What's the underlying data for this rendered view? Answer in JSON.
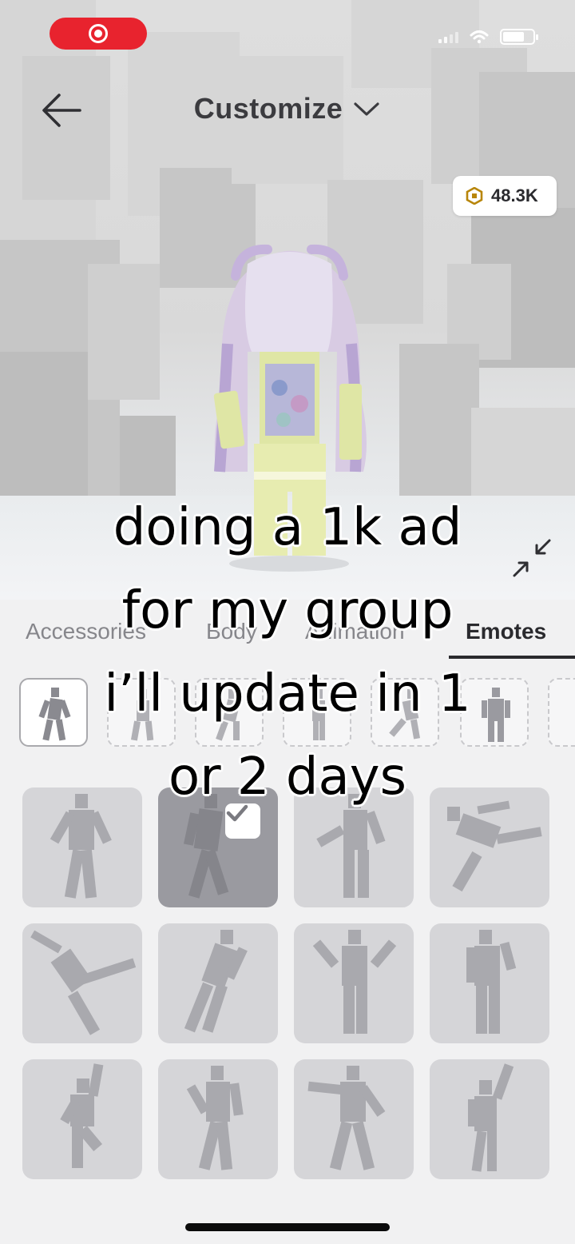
{
  "header": {
    "title": "Customize",
    "currency_amount": "48.3K"
  },
  "tabs": [
    {
      "label": "Accessories",
      "active": false
    },
    {
      "label": "Body",
      "active": false
    },
    {
      "label": "Animation",
      "active": false
    },
    {
      "label": "Emotes",
      "active": true
    }
  ],
  "caption": {
    "lines": [
      "doing a 1k ad",
      "for my group",
      "i’ll update in 1",
      "or 2 days"
    ]
  },
  "grid": {
    "selected_index": 1
  },
  "colors": {
    "record_pill": "#e8232e",
    "tile": "#d5d5d8",
    "tile_selected": "#9a9aa0"
  }
}
